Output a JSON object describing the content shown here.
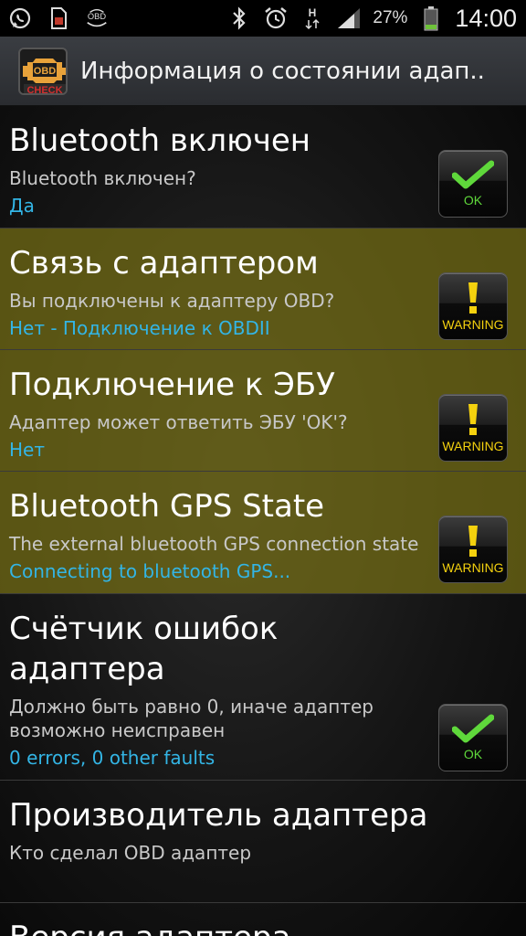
{
  "status_bar": {
    "battery_percent": "27%",
    "time": "14:00",
    "icons": [
      "whatsapp-icon",
      "sim-card-icon",
      "obd-icon",
      "bluetooth-icon",
      "alarm-clock-icon",
      "hspa-data-icon",
      "signal-icon",
      "battery-icon"
    ],
    "data_type": "H"
  },
  "app_bar": {
    "icon_top_text": "OBD",
    "icon_bottom_text": "CHECK",
    "title": "Информация о состоянии адап.."
  },
  "rows": [
    {
      "title": "Bluetooth включен",
      "subtitle": "Bluetooth включен?",
      "value": "Да",
      "status": "OK"
    },
    {
      "title": "Связь с адаптером",
      "subtitle": "Вы подключены к адаптеру OBD?",
      "value": "Нет - Подключение к OBDII",
      "status": "WARNING"
    },
    {
      "title": "Подключение к ЭБУ",
      "subtitle": "Адаптер может ответить ЭБУ 'OK'?",
      "value": "Нет",
      "status": "WARNING"
    },
    {
      "title": "Bluetooth GPS State",
      "subtitle": "The external bluetooth GPS connection state",
      "value": "Connecting to bluetooth GPS...",
      "status": "WARNING"
    },
    {
      "title_line1": "Счётчик ошибок",
      "title_line2": "адаптера",
      "subtitle_line1": "Должно быть равно 0, иначе адаптер",
      "subtitle_line2": "возможно неисправен",
      "value": "0 errors, 0 other faults",
      "status": "OK"
    },
    {
      "title": "Производитель адаптера",
      "subtitle": "Кто сделал OBD адаптер"
    },
    {
      "title": "Версия адаптера"
    }
  ],
  "colors": {
    "value_text": "#33b5e5",
    "warning_row": "#786f14",
    "ok_green": "#5fd83b",
    "warning_yellow": "#f4d10e"
  }
}
